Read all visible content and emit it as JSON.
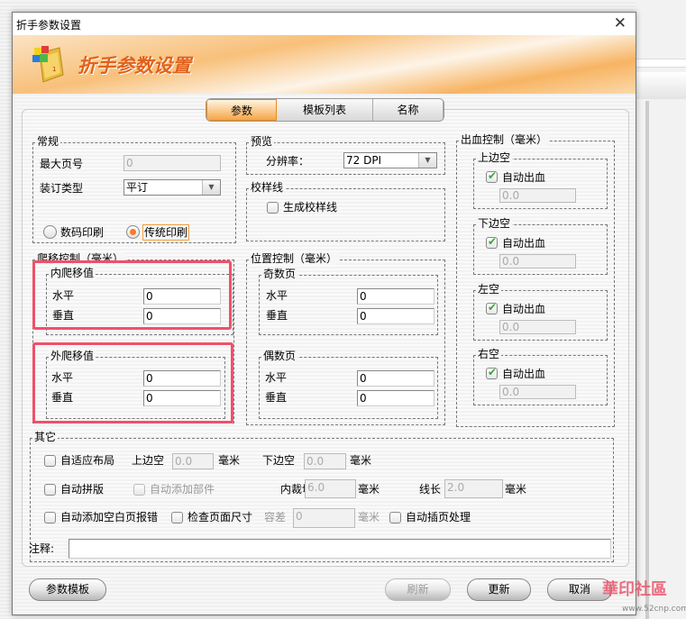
{
  "window": {
    "title": "折手参数设置",
    "banner_title": "折手参数设置",
    "close_icon": "close-icon"
  },
  "tabs": [
    {
      "label": "参数",
      "active": true
    },
    {
      "label": "模板列表"
    },
    {
      "label": "名称"
    }
  ],
  "general": {
    "title": "常规",
    "max_page_label": "最大页号",
    "max_page_value": "0",
    "binding_label": "装订类型",
    "binding_value": "平订",
    "radio_digital": "数码印刷",
    "radio_traditional": "传统印刷",
    "selected": "传统印刷"
  },
  "preview": {
    "title": "预览",
    "resolution_label": "分辨率：",
    "resolution_value": "72 DPI"
  },
  "proof": {
    "title": "校样线",
    "checkbox": "生成校样线",
    "checked": false
  },
  "creep": {
    "title": "爬移控制（毫米）",
    "inner": {
      "title": "内爬移值",
      "h_label": "水平",
      "h_value": "0",
      "v_label": "垂直",
      "v_value": "0"
    },
    "outer": {
      "title": "外爬移值",
      "h_label": "水平",
      "h_value": "0",
      "v_label": "垂直",
      "v_value": "0"
    },
    "highlight_color": "#f0506a"
  },
  "position": {
    "title": "位置控制（毫米）",
    "odd": {
      "title": "奇数页",
      "h_label": "水平",
      "h_value": "0",
      "v_label": "垂直",
      "v_value": "0"
    },
    "even": {
      "title": "偶数页",
      "h_label": "水平",
      "h_value": "0",
      "v_label": "垂直",
      "v_value": "0"
    }
  },
  "bleed": {
    "title": "出血控制（毫米）",
    "sides": [
      {
        "title": "上边空",
        "checkbox": "自动出血",
        "checked": true,
        "value": "0.0"
      },
      {
        "title": "下边空",
        "checkbox": "自动出血",
        "checked": true,
        "value": "0.0"
      },
      {
        "title": "左空",
        "checkbox": "自动出血",
        "checked": true,
        "value": "0.0"
      },
      {
        "title": "右空",
        "checkbox": "自动出血",
        "checked": true,
        "value": "0.0"
      }
    ]
  },
  "other": {
    "title": "其它",
    "adaptive": "自适应布局",
    "top_margin_label": "上边空",
    "top_margin": "0.0",
    "unit": "毫米",
    "bottom_margin_label": "下边空",
    "bottom_margin": "0.0",
    "auto_impose": "自动拼版",
    "auto_add_parts": "自动添加部件",
    "inner_cut_label": "内裁切",
    "inner_cut": "6.0",
    "line_len_label": "线长",
    "line_len": "2.0",
    "blank_page_error": "自动添加空白页报错",
    "check_size": "检查页面尺寸",
    "tolerance_label": "容差",
    "tolerance": "0",
    "auto_insert": "自动插页处理",
    "note_label": "注释:",
    "note_value": ""
  },
  "buttons": {
    "template": "参数模板",
    "refresh": "刷新",
    "update": "更新",
    "cancel": "取消"
  },
  "watermark": {
    "text": "華印社區",
    "url": "www.52cnp.com"
  }
}
